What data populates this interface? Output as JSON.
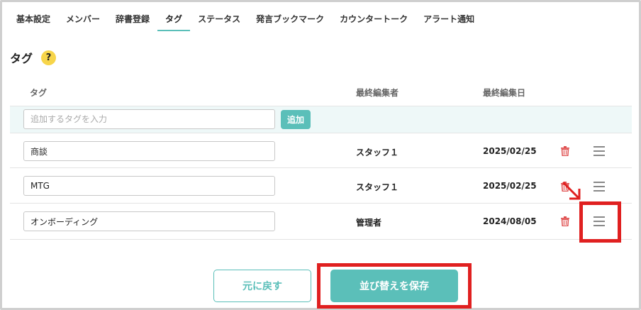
{
  "tabs": [
    {
      "label": "基本設定"
    },
    {
      "label": "メンバー"
    },
    {
      "label": "辞書登録"
    },
    {
      "label": "タグ"
    },
    {
      "label": "ステータス"
    },
    {
      "label": "発言ブックマーク"
    },
    {
      "label": "カウンタートーク"
    },
    {
      "label": "アラート通知"
    }
  ],
  "active_tab": "タグ",
  "section": {
    "title": "タグ",
    "help_symbol": "?"
  },
  "table": {
    "headers": {
      "tag": "タグ",
      "editor": "最終編集者",
      "date": "最終編集日"
    },
    "new_tag": {
      "placeholder": "追加するタグを入力",
      "value": "",
      "add_label": "追加"
    },
    "rows": [
      {
        "tag": "商談",
        "editor": "スタッフ１",
        "date": "2025/02/25"
      },
      {
        "tag": "MTG",
        "editor": "スタッフ１",
        "date": "2025/02/25"
      },
      {
        "tag": "オンボーディング",
        "editor": "管理者",
        "date": "2024/08/05"
      }
    ]
  },
  "icons": {
    "delete": "trash-icon",
    "reorder": "drag-handle-icon",
    "annotation": "arrow-down-right-icon"
  },
  "buttons": {
    "revert": "元に戻す",
    "save": "並び替えを保存"
  },
  "colors": {
    "accent": "#5bbfb9",
    "delete": "#e05050",
    "highlight": "#e02020",
    "help": "#f7d54a"
  }
}
